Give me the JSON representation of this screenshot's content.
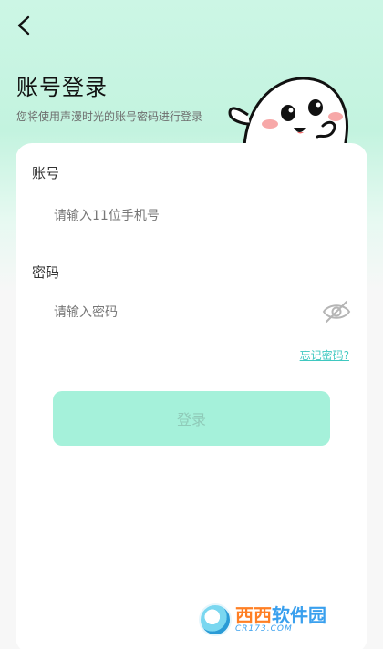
{
  "header": {
    "back_icon": "chevron-left-icon",
    "title": "账号登录",
    "subtitle": "您将使用声漫时光的账号密码进行登录"
  },
  "form": {
    "account": {
      "label": "账号",
      "placeholder": "请输入11位手机号",
      "value": ""
    },
    "password": {
      "label": "密码",
      "placeholder": "请输入密码",
      "value": "",
      "toggle_icon": "eye-hidden-icon"
    },
    "forgot_label": "忘记密码?",
    "login_label": "登录"
  },
  "watermark": {
    "main_left": "西西",
    "main_right": "软件园",
    "sub": "CR173.COM"
  },
  "colors": {
    "accent": "#a5f1da",
    "link": "#3fc8c0",
    "header_bg": "#c3f3df"
  }
}
